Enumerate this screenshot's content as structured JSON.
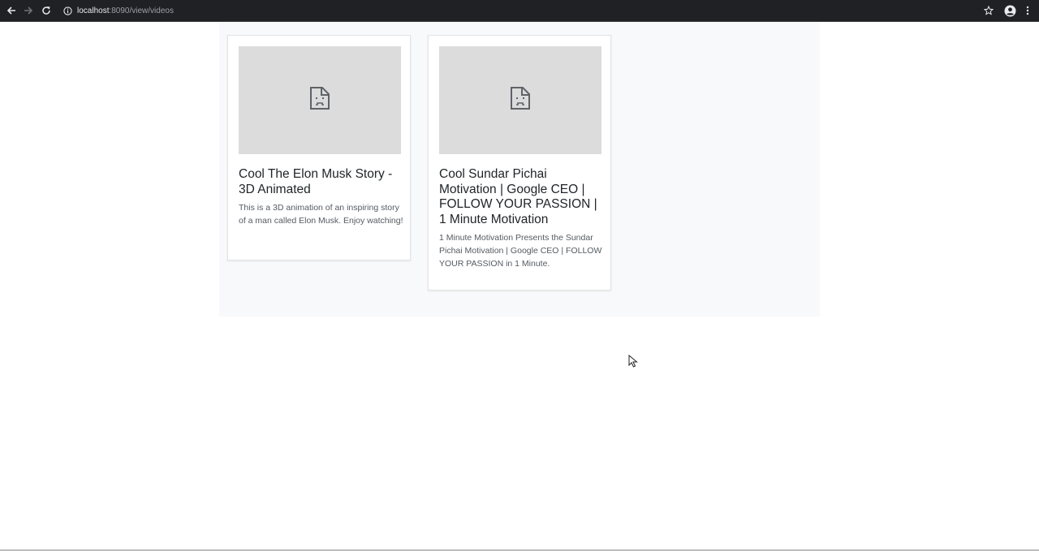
{
  "browser": {
    "url_host": "localhost",
    "url_rest": ":8090/view/videos",
    "icons": {
      "back": "back-arrow-icon",
      "forward": "forward-arrow-icon",
      "reload": "reload-icon",
      "info": "info-icon",
      "bookmark": "star-icon",
      "profile": "account-icon",
      "menu": "kebab-menu-icon"
    }
  },
  "videos": [
    {
      "title": "Cool The Elon Musk Story - 3D Animated",
      "description": "This is a 3D animation of an inspiring story of a man called Elon Musk. Enjoy watching!",
      "thumbnail_icon": "broken-image-icon"
    },
    {
      "title": "Cool Sundar Pichai Motivation | Google CEO | FOLLOW YOUR PASSION | 1 Minute Motivation",
      "description": "1 Minute Motivation Presents the Sundar Pichai Motivation | Google CEO | FOLLOW YOUR PASSION in 1 Minute.",
      "thumbnail_icon": "broken-image-icon"
    }
  ],
  "colors": {
    "toolbar_bg": "#202124",
    "container_bg": "#f8f9fa",
    "thumbnail_bg": "#dcdcdc",
    "title_text": "#212529",
    "body_text": "#555b61"
  }
}
